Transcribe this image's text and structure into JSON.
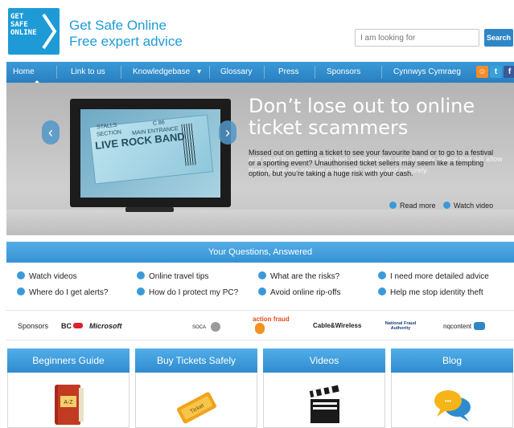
{
  "header": {
    "logo_text_1": "GET",
    "logo_text_2": "SAFE",
    "logo_text_3": "ONLINE",
    "title": "Get Safe Online",
    "subtitle": "Free expert advice",
    "search_placeholder": "I am looking for",
    "search_button": "Search"
  },
  "nav": {
    "items": [
      {
        "label": "Home"
      },
      {
        "label": "Link to us"
      },
      {
        "label": "Knowledgebase"
      },
      {
        "label": "Glossary"
      },
      {
        "label": "Press"
      },
      {
        "label": "Sponsors"
      },
      {
        "label": "Cynnwys Cymraeg"
      }
    ],
    "dropdown_glyph": "▾",
    "social": [
      {
        "icon": "rss-icon",
        "glyph": "☺",
        "color": "#f58b2a"
      },
      {
        "icon": "twitter-icon",
        "glyph": "t",
        "color": "#3aa1d8"
      },
      {
        "icon": "facebook-icon",
        "glyph": "f",
        "color": "#3b5998"
      }
    ]
  },
  "hero": {
    "title": "Don’t lose out to online ticket scammers",
    "body": "Missed out on getting a ticket to see your favourite band or to go to a festival or a sporting event? Unauthorised ticket sellers may seem like a tempting option, but you’re taking a huge risk with your cash.",
    "ghost_text": "and small businesses with free, independent, user-friendly advice that will allow them to use the internet confidently, safely and securely.",
    "read_more": "Read more",
    "watch_video": "Watch video",
    "prev_arrow": "‹",
    "next_arrow": "›",
    "ticket": {
      "stalls": "STALLS",
      "section": "SECTION",
      "main_entrance": "MAIN ENTRANCE",
      "seat": "C 86",
      "band": "LIVE ROCK BAND"
    }
  },
  "questions": {
    "title": "Your Questions, Answered",
    "items": [
      {
        "label": "Watch videos"
      },
      {
        "label": "Online travel tips"
      },
      {
        "label": "What are the risks?"
      },
      {
        "label": "I need more detailed advice"
      },
      {
        "label": "Where do I get alerts?"
      },
      {
        "label": "How do I protect my PC?"
      },
      {
        "label": "Avoid online rip-offs"
      },
      {
        "label": "Help me stop identity theft"
      }
    ]
  },
  "sponsors": {
    "label": "Sponsors",
    "items": [
      {
        "name": "BC"
      },
      {
        "name": "Microsoft"
      },
      {
        "name": "SOCA"
      },
      {
        "name": "action fraud"
      },
      {
        "name": "Cable&Wireless"
      },
      {
        "name": "National Fraud Authority"
      },
      {
        "name": "nqcontent"
      }
    ]
  },
  "cards": [
    {
      "title": "Beginners Guide",
      "icon": "a-z-book-icon"
    },
    {
      "title": "Buy Tickets Safely",
      "icon": "ticket-icon"
    },
    {
      "title": "Videos",
      "icon": "clapperboard-icon"
    },
    {
      "title": "Blog",
      "icon": "chat-bubbles-icon"
    }
  ],
  "icon_text": {
    "az": "A-Z",
    "ticket": "Ticket",
    "dots": "•••"
  },
  "colors": {
    "brand": "#1e9bd7",
    "nav": "#2f86c7",
    "accent_orange": "#f0a31c"
  }
}
